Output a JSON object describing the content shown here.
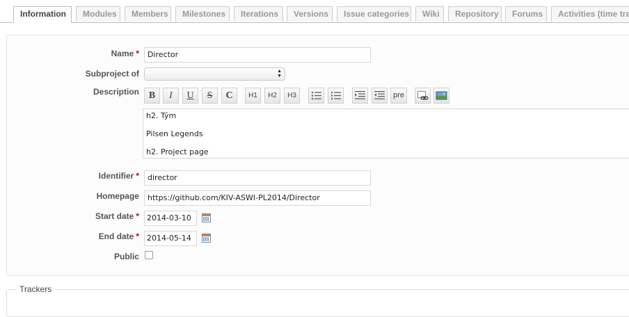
{
  "tabs": [
    {
      "label": "Information",
      "selected": true
    },
    {
      "label": "Modules"
    },
    {
      "label": "Members"
    },
    {
      "label": "Milestones"
    },
    {
      "label": "Iterations"
    },
    {
      "label": "Versions"
    },
    {
      "label": "Issue categories"
    },
    {
      "label": "Wiki"
    },
    {
      "label": "Repository"
    },
    {
      "label": "Forums"
    },
    {
      "label": "Activities (time tracking)"
    }
  ],
  "form": {
    "name": {
      "label": "Name",
      "required": "*",
      "value": "Director"
    },
    "subproject": {
      "label": "Subproject of",
      "value": ""
    },
    "description": {
      "label": "Description",
      "lines": [
        "h2. Tým",
        "Pilsen Legends",
        "h2. Project page"
      ]
    },
    "identifier": {
      "label": "Identifier",
      "required": "*",
      "value": "director"
    },
    "homepage": {
      "label": "Homepage",
      "value": "https://github.com/KIV-ASWI-PL2014/Director"
    },
    "start_date": {
      "label": "Start date",
      "required": "*",
      "value": "2014-03-10"
    },
    "end_date": {
      "label": "End date",
      "required": "*",
      "value": "2014-05-14"
    },
    "public": {
      "label": "Public",
      "checked": false
    }
  },
  "toolbar": {
    "bold": "B",
    "italic": "I",
    "underline": "U",
    "strike": "S",
    "code": "C",
    "h1": "H1",
    "h2": "H2",
    "h3": "H3",
    "pre": "pre"
  },
  "trackers": {
    "legend": "Trackers"
  },
  "colors": {
    "required": "#bb0000",
    "tab_selected_text": "#444444",
    "tab_text": "#999999"
  }
}
